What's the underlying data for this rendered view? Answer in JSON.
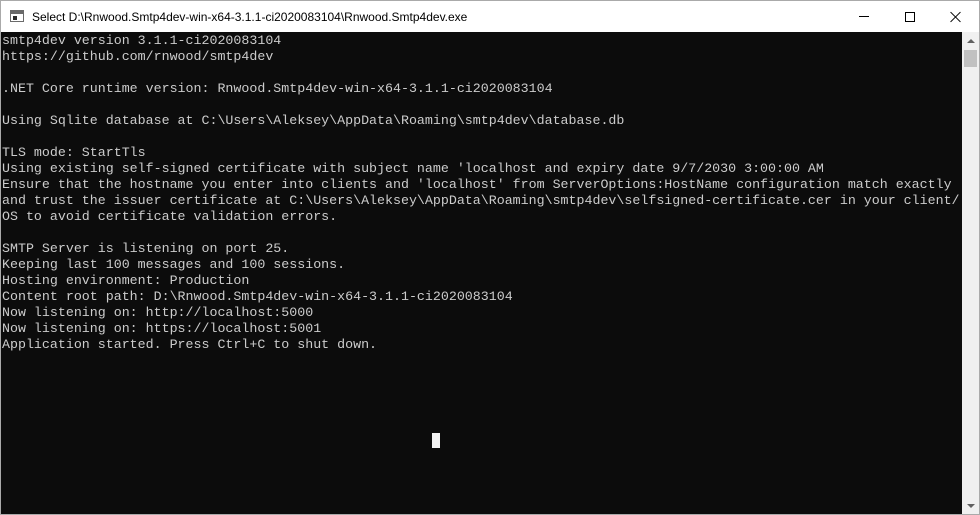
{
  "window": {
    "title": "Select D:\\Rnwood.Smtp4dev-win-x64-3.1.1-ci2020083104\\Rnwood.Smtp4dev.exe",
    "icon": "console-window-icon"
  },
  "caption_buttons": {
    "minimize": "minimize-icon",
    "maximize": "maximize-icon",
    "close": "close-icon"
  },
  "console": {
    "background": "#0c0c0c",
    "foreground": "#cccccc",
    "lines": [
      "smtp4dev version 3.1.1-ci2020083104",
      "https://github.com/rnwood/smtp4dev",
      "",
      ".NET Core runtime version: Rnwood.Smtp4dev-win-x64-3.1.1-ci2020083104",
      "",
      "Using Sqlite database at C:\\Users\\Aleksey\\AppData\\Roaming\\smtp4dev\\database.db",
      "",
      "TLS mode: StartTls",
      "Using existing self-signed certificate with subject name 'localhost and expiry date 9/7/2030 3:00:00 AM",
      "Ensure that the hostname you enter into clients and 'localhost' from ServerOptions:HostName configuration match exactly",
      "and trust the issuer certificate at C:\\Users\\Aleksey\\AppData\\Roaming\\smtp4dev\\selfsigned-certificate.cer in your client/",
      "OS to avoid certificate validation errors.",
      "",
      "SMTP Server is listening on port 25.",
      "Keeping last 100 messages and 100 sessions.",
      "Hosting environment: Production",
      "Content root path: D:\\Rnwood.Smtp4dev-win-x64-3.1.1-ci2020083104",
      "Now listening on: http://localhost:5000",
      "Now listening on: https://localhost:5001",
      "Application started. Press Ctrl+C to shut down."
    ]
  }
}
